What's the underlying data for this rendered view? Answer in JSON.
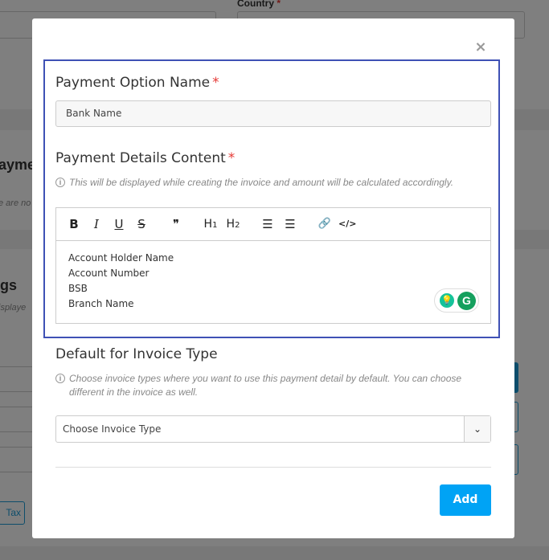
{
  "background": {
    "country_label": "Country",
    "country_required": "*",
    "section_heading_partial": "ayme",
    "section_note_partial": "e are no",
    "settings_heading_partial": "gs",
    "settings_note_partial": "isplaye",
    "tax_button_partial": "Tax"
  },
  "modal": {
    "close_icon": "×",
    "payment_option_name": {
      "label": "Payment Option Name",
      "required": "*",
      "value": "Bank Name"
    },
    "payment_details": {
      "label": "Payment Details Content",
      "required": "*",
      "hint_icon": "i",
      "hint": "This will be displayed while creating the invoice and amount will be calculated accordingly.",
      "toolbar": {
        "bold": "B",
        "italic": "I",
        "underline": "U",
        "strike": "S",
        "quote": "❞",
        "h1": "H",
        "h1_sub": "1",
        "h2": "H",
        "h2_sub": "2",
        "ordered_list": "☰",
        "bullet_list": "☰",
        "link": "🔗",
        "code": "</>"
      },
      "content_lines": [
        "Account Holder Name",
        "Account Number",
        "BSB",
        "Branch Name"
      ],
      "grammarly_bulb": "💡",
      "grammarly_logo": "G"
    },
    "default_invoice": {
      "label": "Default for Invoice Type",
      "hint_icon": "i",
      "hint": "Choose invoice types where you want to use this payment detail by default. You can choose different in the invoice as well.",
      "select_value": "Choose Invoice Type",
      "select_arrow": "⌄"
    },
    "add_button": "Add"
  },
  "colors": {
    "accent": "#00a3f5",
    "focus_border": "#3f51b5",
    "required": "#e53935"
  }
}
